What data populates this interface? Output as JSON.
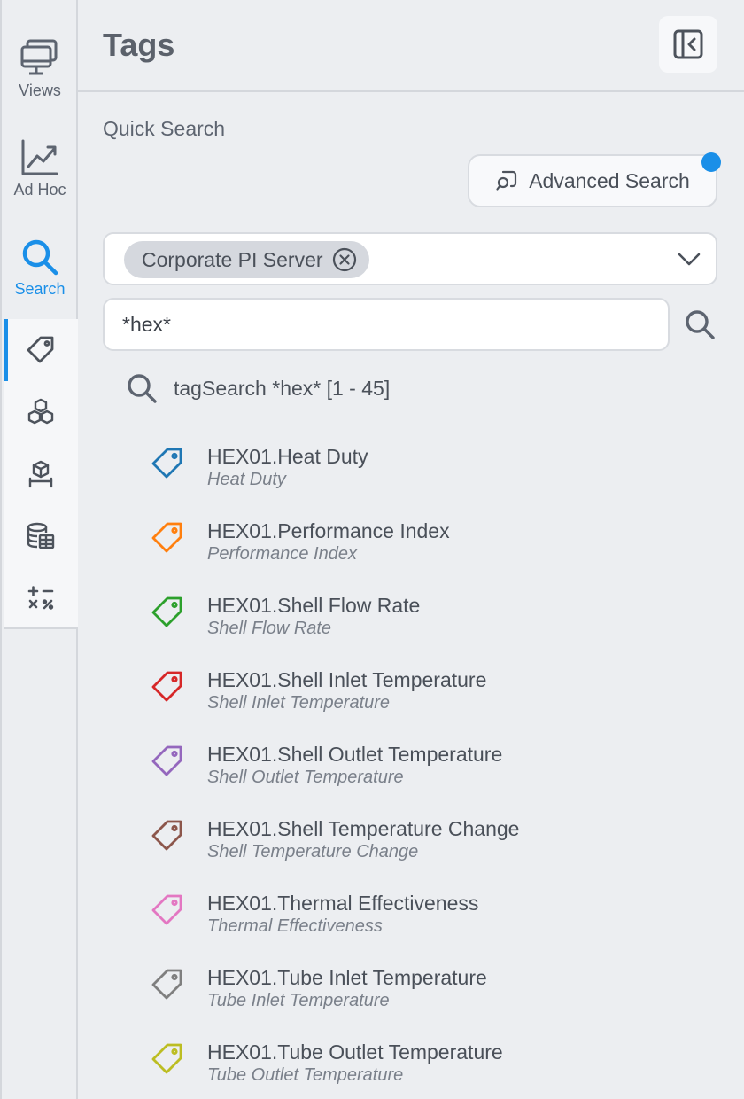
{
  "rail": {
    "views_label": "Views",
    "adhoc_label": "Ad Hoc",
    "search_label": "Search",
    "accent": "#1a8fe8"
  },
  "panel": {
    "title": "Tags"
  },
  "quick_search": {
    "label": "Quick Search",
    "advanced_button": "Advanced Search",
    "server_chip": "Corporate PI Server",
    "query": "*hex*",
    "result_summary": "tagSearch *hex* [1 - 45]"
  },
  "tags": [
    {
      "name": "HEX01.Heat Duty",
      "description": "Heat Duty",
      "color": "#1f77b4"
    },
    {
      "name": "HEX01.Performance Index",
      "description": "Performance Index",
      "color": "#ff7f0e"
    },
    {
      "name": "HEX01.Shell Flow Rate",
      "description": "Shell Flow Rate",
      "color": "#2ca02c"
    },
    {
      "name": "HEX01.Shell Inlet Temperature",
      "description": "Shell Inlet Temperature",
      "color": "#d62728"
    },
    {
      "name": "HEX01.Shell Outlet Temperature",
      "description": "Shell Outlet Temperature",
      "color": "#9467bd"
    },
    {
      "name": "HEX01.Shell Temperature Change",
      "description": "Shell Temperature Change",
      "color": "#8c564b"
    },
    {
      "name": "HEX01.Thermal Effectiveness",
      "description": "Thermal Effectiveness",
      "color": "#e377c2"
    },
    {
      "name": "HEX01.Tube Inlet Temperature",
      "description": "Tube Inlet Temperature",
      "color": "#7f7f7f"
    },
    {
      "name": "HEX01.Tube Outlet Temperature",
      "description": "Tube Outlet Temperature",
      "color": "#bcbd22"
    }
  ]
}
